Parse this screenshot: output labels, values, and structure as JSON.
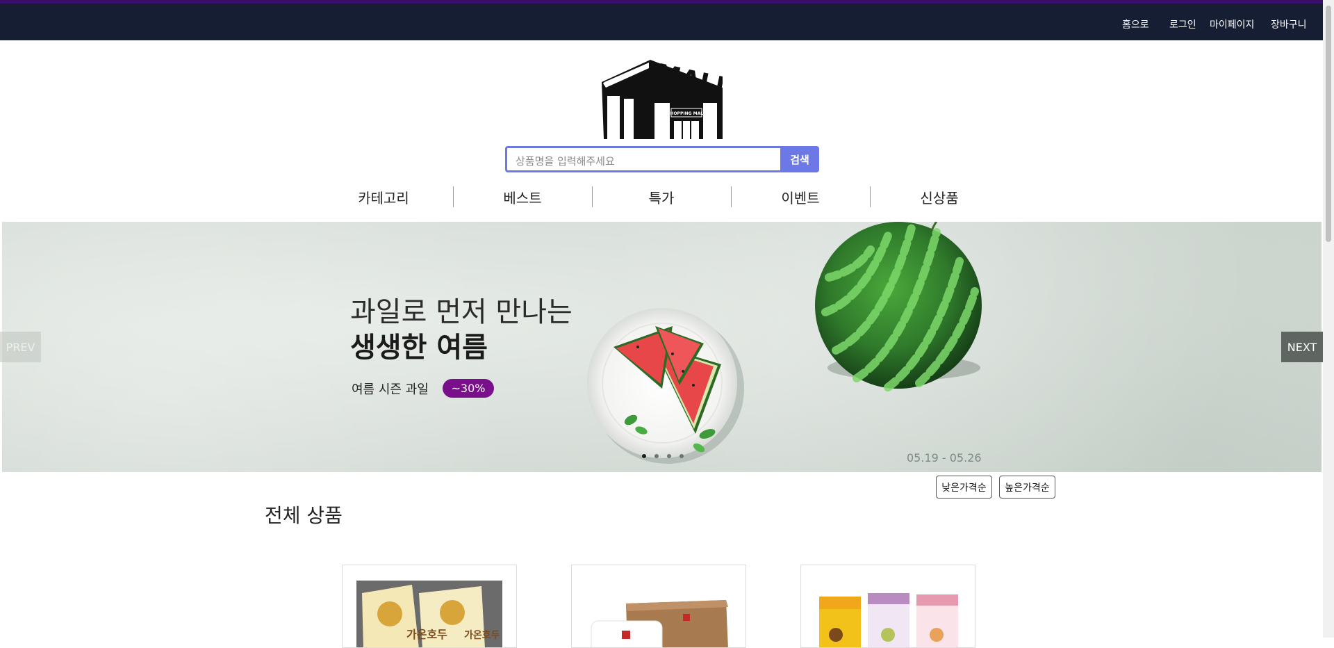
{
  "topnav": {
    "home": "홈으로",
    "login": "로그인",
    "mypage": "마이페이지",
    "cart": "장바구니"
  },
  "logo": {
    "title": "MALL",
    "sign": "SHOPPING MALL"
  },
  "search": {
    "placeholder": "상품명을 입력해주세요",
    "button": "검색"
  },
  "menu": {
    "items": [
      "카테고리",
      "베스트",
      "특가",
      "이벤트",
      "신상품"
    ]
  },
  "banner": {
    "line1": "과일로 먼저 만나는",
    "line2": "생생한 여름",
    "subtitle": "여름 시즌 과일",
    "badge": "~30%",
    "date": "05.19 - 05.26",
    "prev": "PREV",
    "next": "NEXT",
    "slide_count": 4,
    "active_slide": 1
  },
  "sort": {
    "low": "낮은가격순",
    "high": "높은가격순"
  },
  "products": {
    "title": "전체 상품",
    "items": [
      {
        "label": "가온호두"
      },
      {
        "label": ""
      },
      {
        "label": ""
      }
    ]
  },
  "colors": {
    "topbar": "#151e33",
    "accent": "#6c78e6",
    "badge": "#7a0f8c"
  }
}
